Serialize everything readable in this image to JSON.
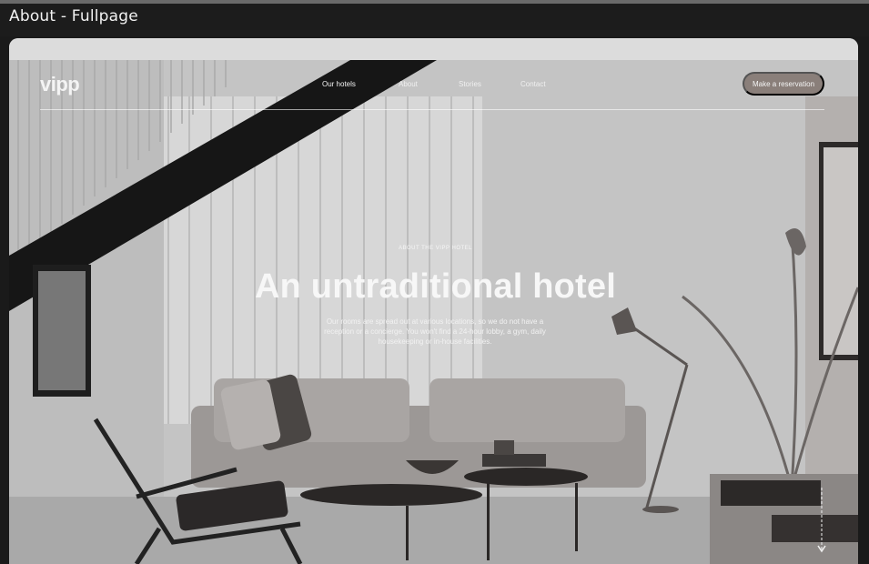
{
  "window": {
    "title": "About - Fullpage"
  },
  "nav": {
    "logo": "vipp",
    "links": [
      "Our hotels",
      "About",
      "Stories",
      "Contact"
    ],
    "cta": "Make a reservation"
  },
  "hero": {
    "eyebrow": "ABOUT THE VIPP HOTEL",
    "headline": "An untraditional hotel",
    "body": "Our rooms are spread out at various locations, so we do not have a reception or a concierge. You won't find a 24-hour lobby, a gym, daily housekeeping or in-house facilities."
  },
  "icons": {
    "scroll": "arrow-down-icon"
  }
}
